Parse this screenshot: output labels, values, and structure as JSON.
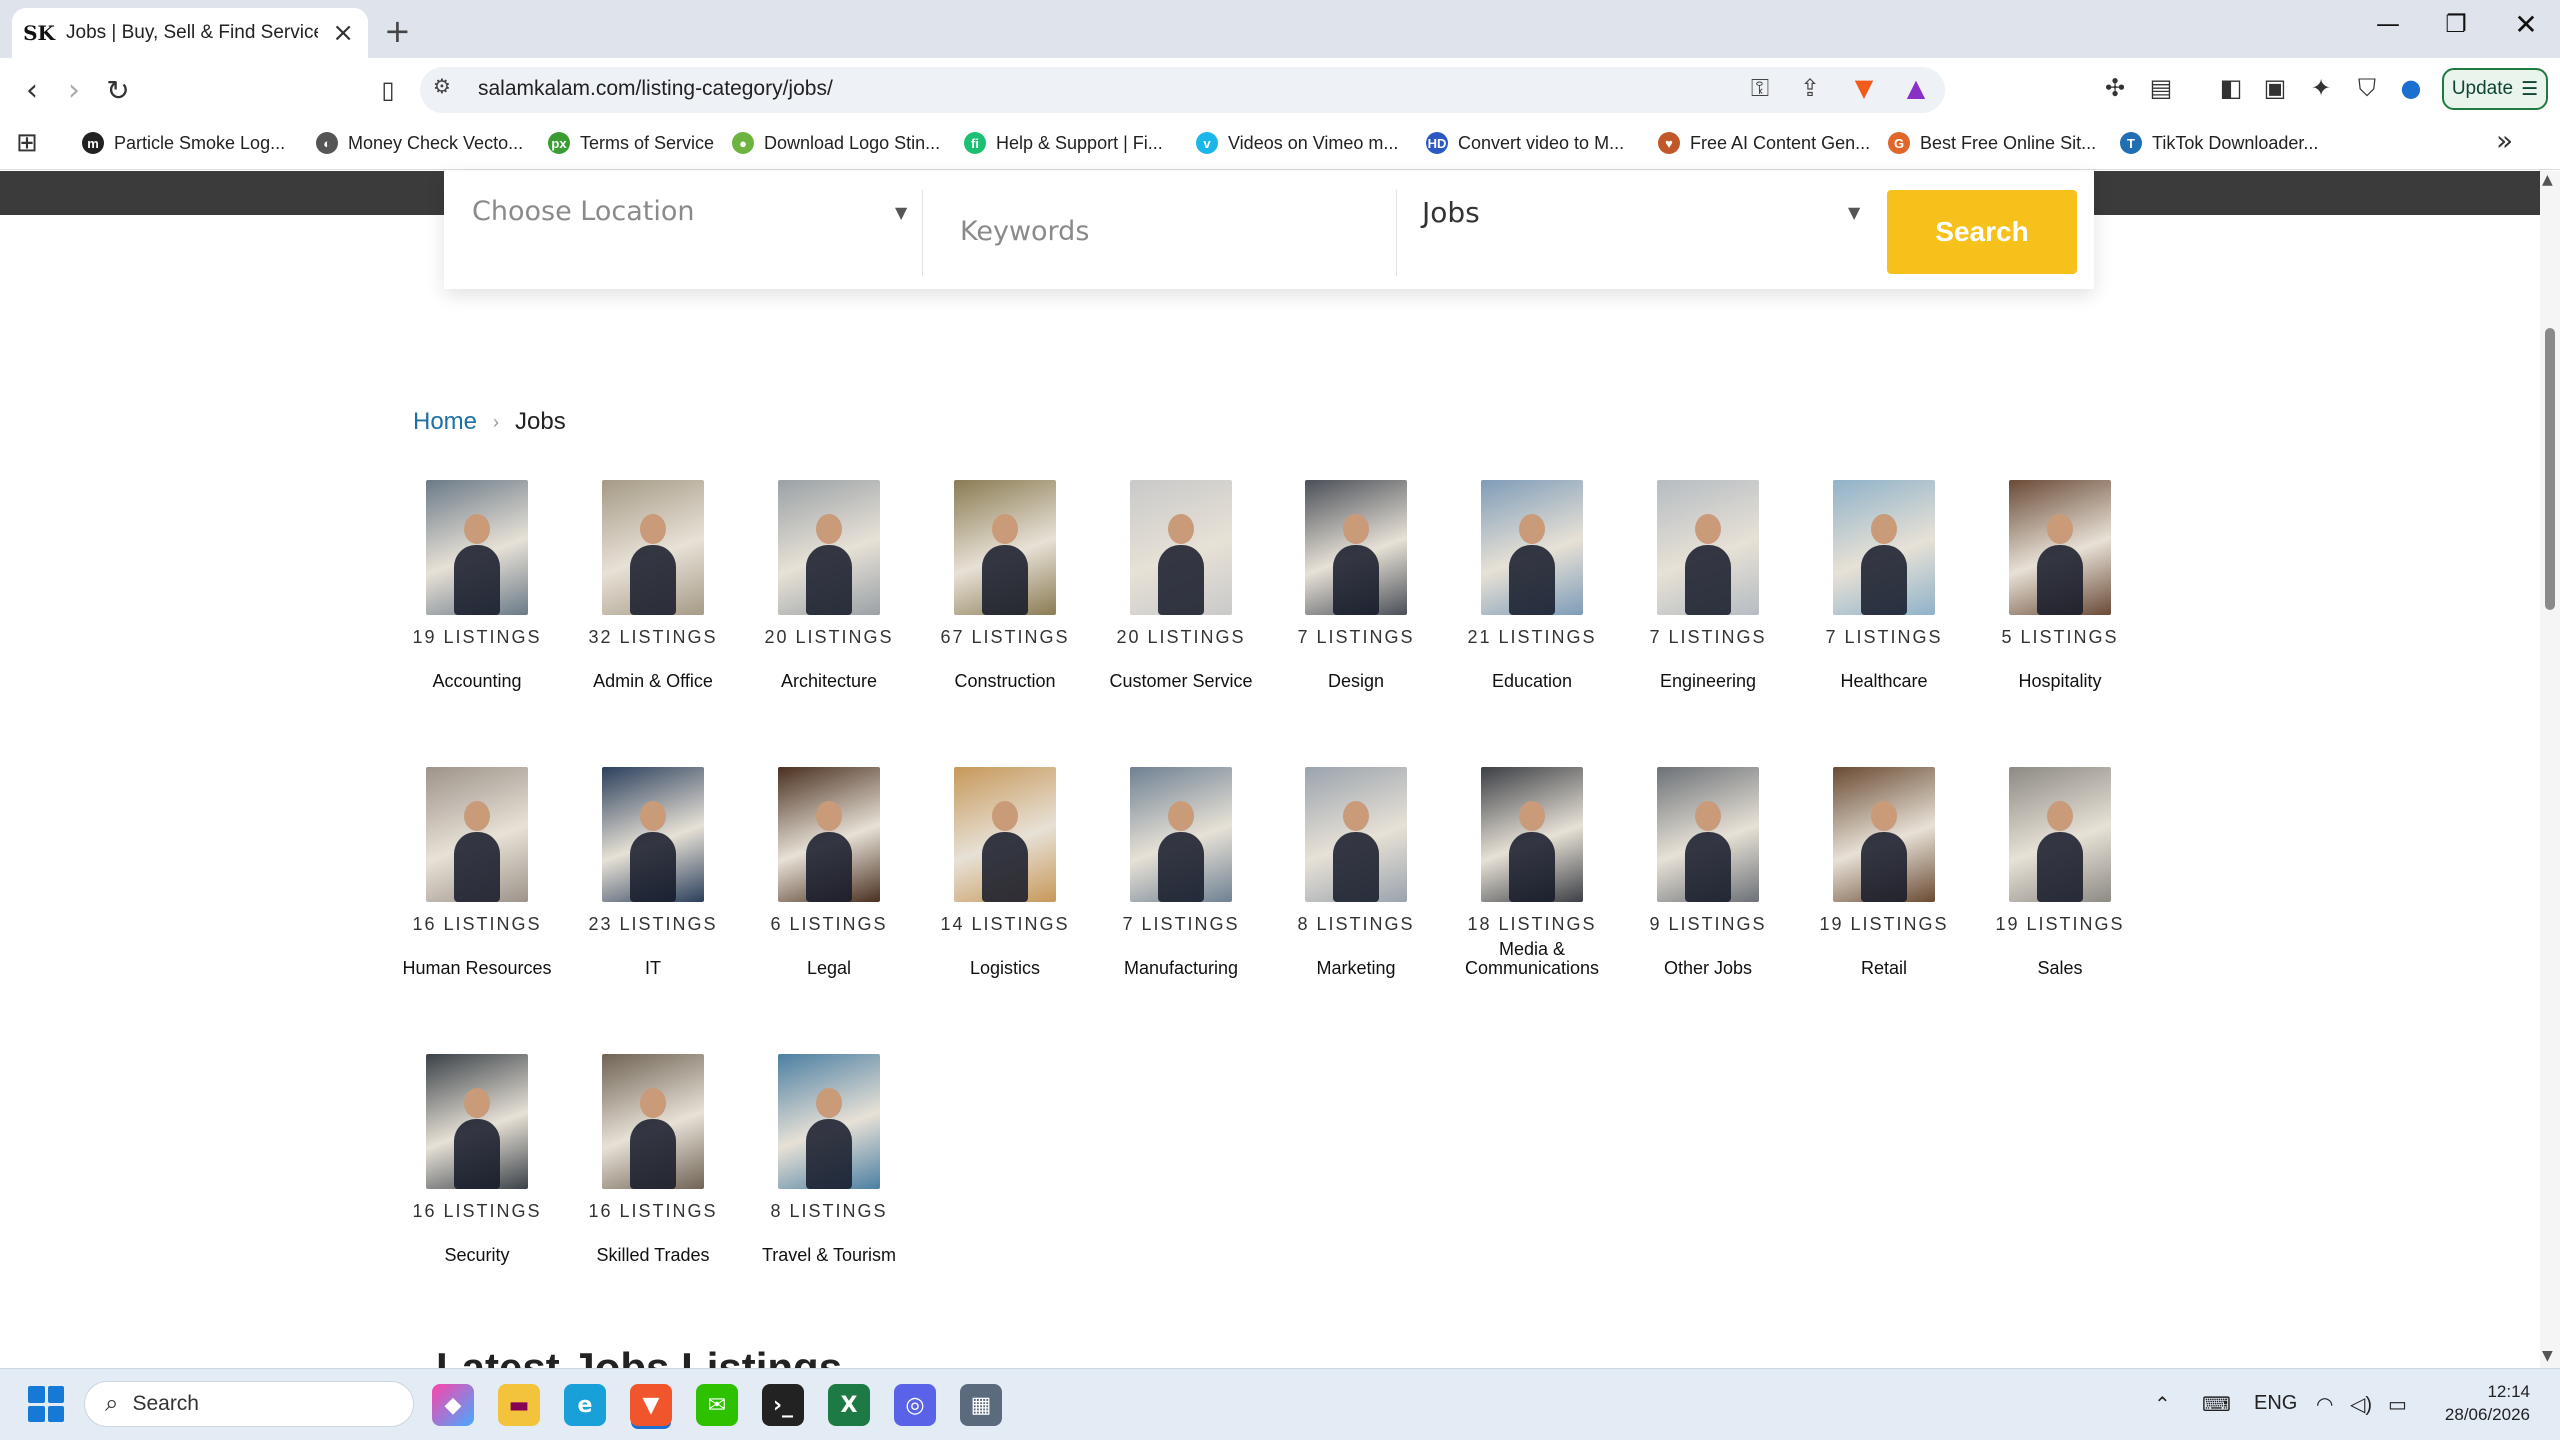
{
  "browser": {
    "tab_title": "Jobs | Buy, Sell & Find Services W",
    "tab_favicon": "SK",
    "url": "salamkalam.com/listing-category/jobs/",
    "update_label": "Update",
    "bookmarks": [
      {
        "label": "Particle Smoke Log...",
        "color": "#222222",
        "glyph": "m"
      },
      {
        "label": "Money Check Vecto...",
        "color": "#555555",
        "glyph": "◐"
      },
      {
        "label": "Terms of Service",
        "color": "#3a9d33",
        "glyph": "px"
      },
      {
        "label": "Download Logo Stin...",
        "color": "#6db33f",
        "glyph": "●"
      },
      {
        "label": "Help & Support | Fi...",
        "color": "#1dbf73",
        "glyph": "fi"
      },
      {
        "label": "Videos on Vimeo m...",
        "color": "#1ab7ea",
        "glyph": "v"
      },
      {
        "label": "Convert video to M...",
        "color": "#2b59c3",
        "glyph": "HD"
      },
      {
        "label": "Free AI Content Gen...",
        "color": "#c2572a",
        "glyph": "♥"
      },
      {
        "label": "Best Free Online Sit...",
        "color": "#e0662a",
        "glyph": "G"
      },
      {
        "label": "TikTok Downloader...",
        "color": "#1f6fb2",
        "glyph": "T"
      }
    ]
  },
  "search": {
    "location_placeholder": "Choose Location",
    "keywords_placeholder": "Keywords",
    "category_value": "Jobs",
    "button_label": "Search"
  },
  "breadcrumb": {
    "home": "Home",
    "separator": "›",
    "current": "Jobs"
  },
  "categories": [
    {
      "count": "19 LISTINGS",
      "name": "Accounting",
      "bg": "#6b7a88"
    },
    {
      "count": "32 LISTINGS",
      "name": "Admin & Office",
      "bg": "#a59a86"
    },
    {
      "count": "20 LISTINGS",
      "name": "Architecture",
      "bg": "#9aa1a6"
    },
    {
      "count": "67 LISTINGS",
      "name": "Construction",
      "bg": "#8a7b52"
    },
    {
      "count": "20 LISTINGS",
      "name": "Customer Service",
      "bg": "#c9c9c9"
    },
    {
      "count": "7 LISTINGS",
      "name": "Design",
      "bg": "#4a4f58"
    },
    {
      "count": "21 LISTINGS",
      "name": "Education",
      "bg": "#7e9cb8"
    },
    {
      "count": "7 LISTINGS",
      "name": "Engineering",
      "bg": "#b5bcc2"
    },
    {
      "count": "7 LISTINGS",
      "name": "Healthcare",
      "bg": "#8fb2c9"
    },
    {
      "count": "5 LISTINGS",
      "name": "Hospitality",
      "bg": "#6a4a36"
    },
    {
      "count": "16 LISTINGS",
      "name": "Human Resources",
      "bg": "#9d938a"
    },
    {
      "count": "23 LISTINGS",
      "name": "IT",
      "bg": "#2b3f5c"
    },
    {
      "count": "6 LISTINGS",
      "name": "Legal",
      "bg": "#4a3020"
    },
    {
      "count": "14 LISTINGS",
      "name": "Logistics",
      "bg": "#c7985a"
    },
    {
      "count": "7 LISTINGS",
      "name": "Manufacturing",
      "bg": "#6f8193"
    },
    {
      "count": "8 LISTINGS",
      "name": "Marketing",
      "bg": "#9aa3ad"
    },
    {
      "count": "18 LISTINGS",
      "name": "Media & Communications",
      "bg": "#3c3f45"
    },
    {
      "count": "9 LISTINGS",
      "name": "Other Jobs",
      "bg": "#6c7177"
    },
    {
      "count": "19 LISTINGS",
      "name": "Retail",
      "bg": "#6a4b33"
    },
    {
      "count": "19 LISTINGS",
      "name": "Sales",
      "bg": "#8d8a84"
    },
    {
      "count": "16 LISTINGS",
      "name": "Security",
      "bg": "#3a4148"
    },
    {
      "count": "16 LISTINGS",
      "name": "Skilled Trades",
      "bg": "#6f6354"
    },
    {
      "count": "8 LISTINGS",
      "name": "Travel & Tourism",
      "bg": "#4c7fa3"
    }
  ],
  "latest_heading": "Latest Jobs Listings",
  "taskbar": {
    "search_label": "Search",
    "language": "ENG",
    "time": "12:14",
    "date": "28/06/2026"
  }
}
